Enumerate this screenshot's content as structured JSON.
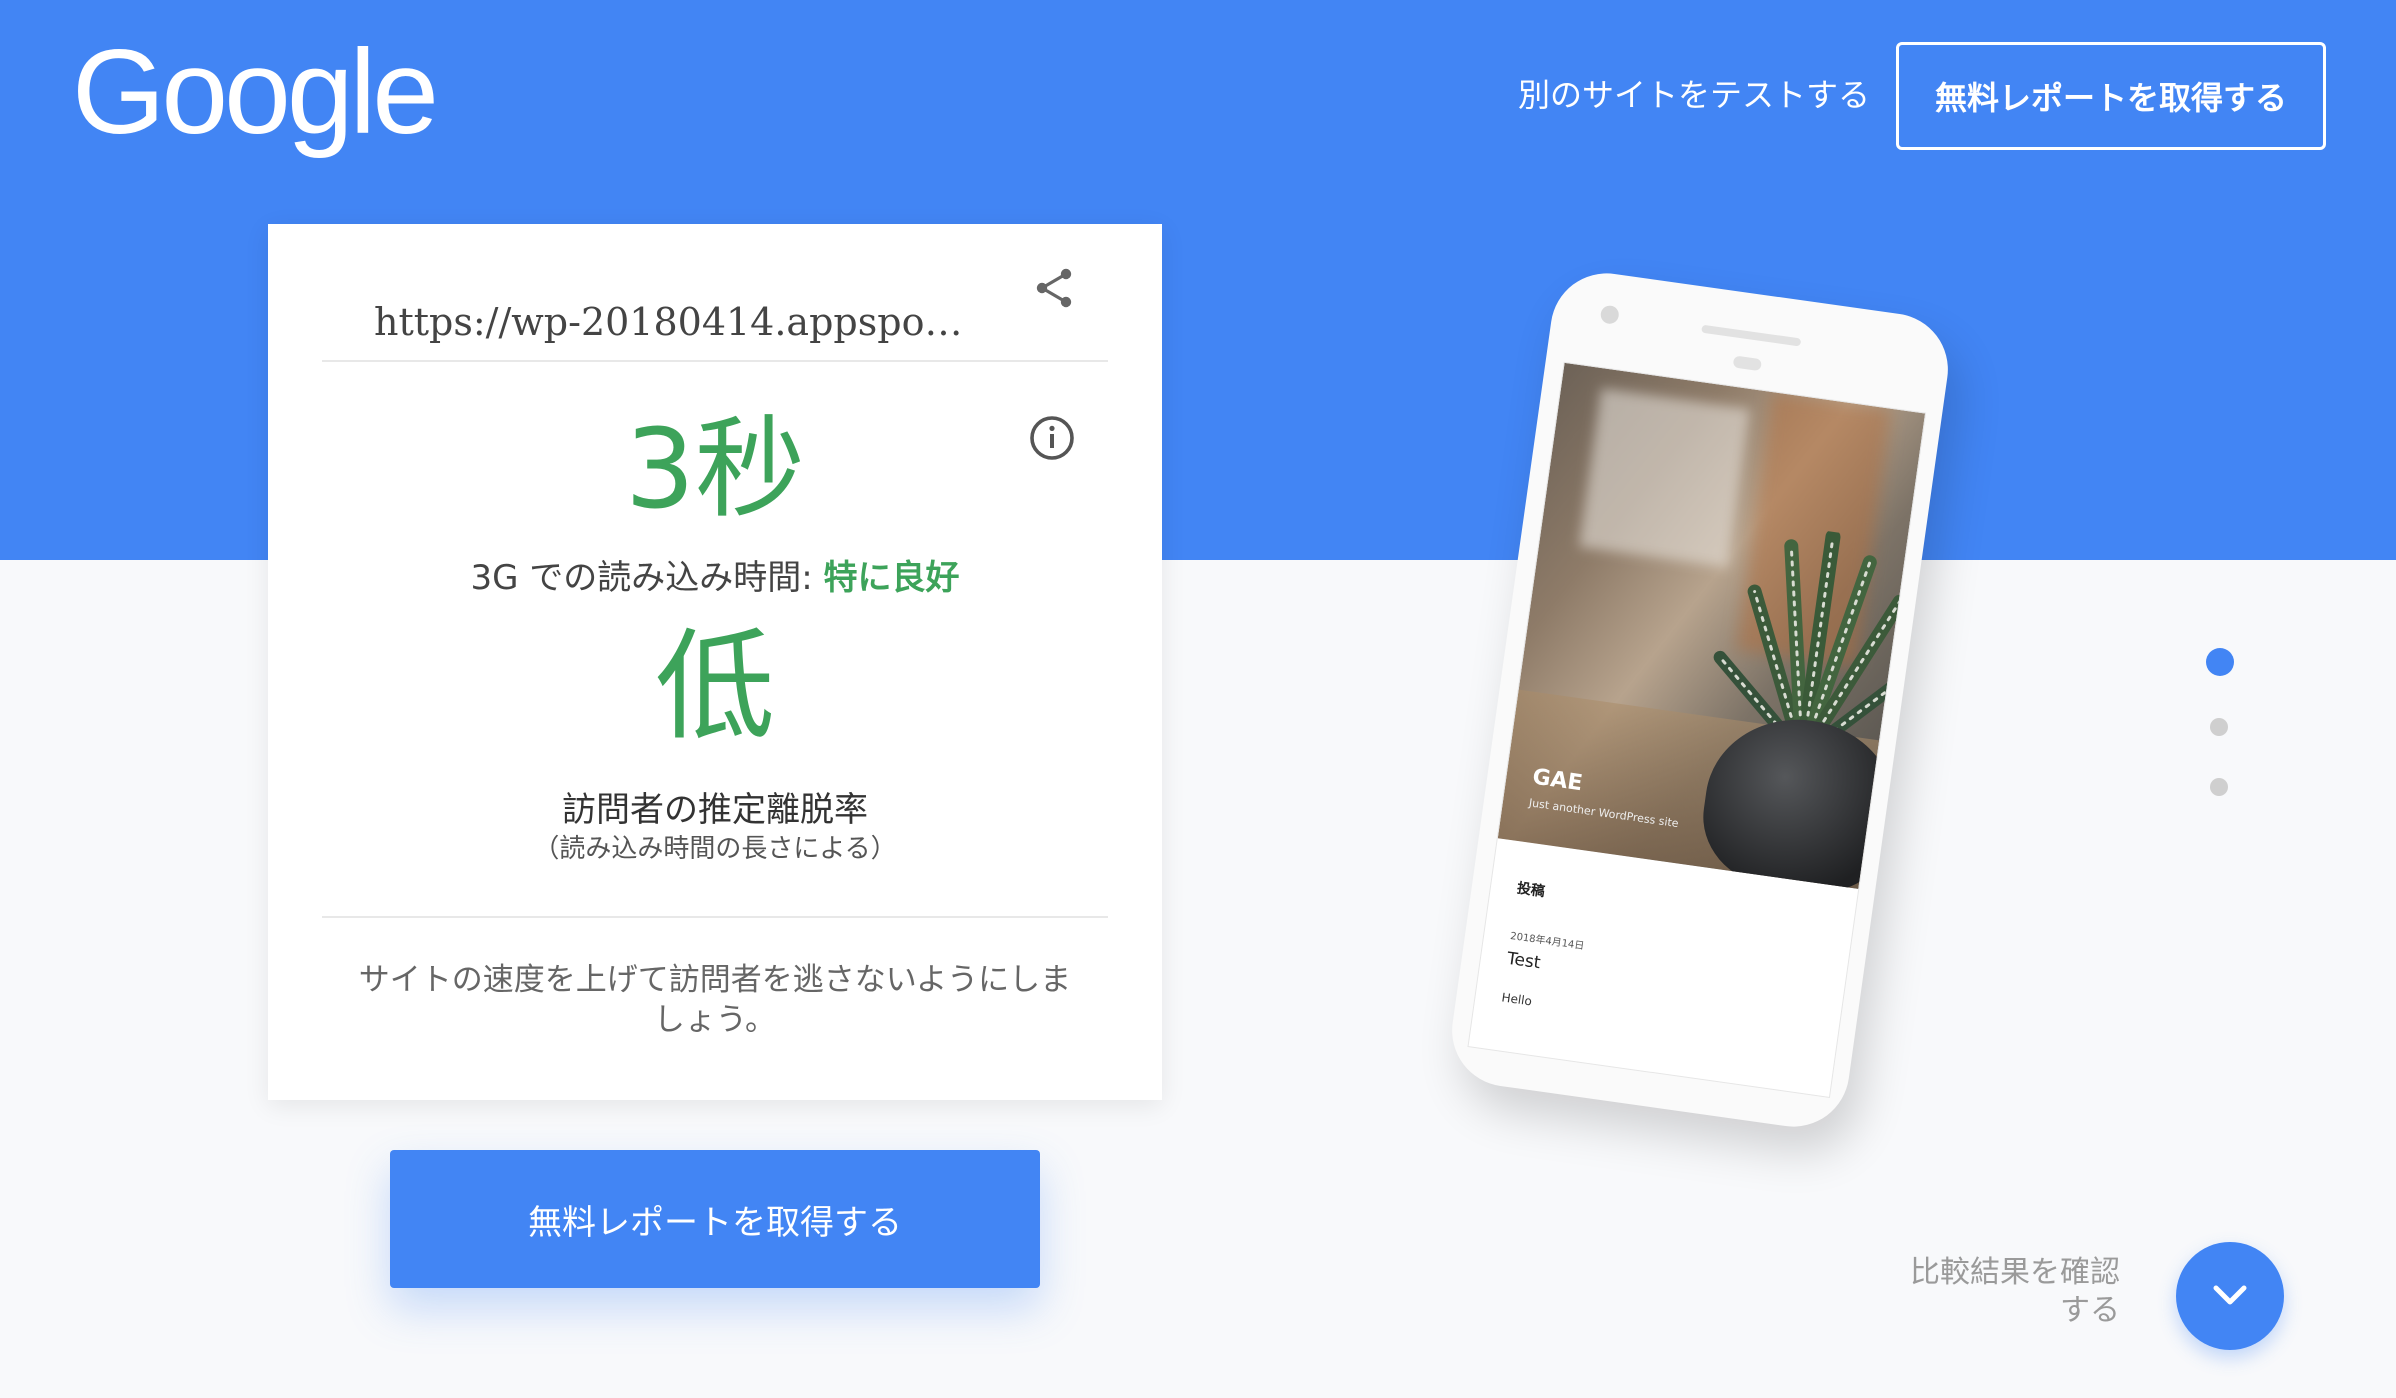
{
  "header": {
    "logo_text": "Google",
    "test_other_site": "別のサイトをテストする",
    "get_report": "無料レポートを取得する"
  },
  "result_card": {
    "url": "https://wp-20180414.appspot....",
    "load_time": "3秒",
    "load_time_caption_prefix": "3G での読み込み時間: ",
    "load_time_rating": "特に良好",
    "bounce_rate": "低",
    "bounce_label": "訪問者の推定離脱率",
    "bounce_sublabel": "（読み込み時間の長さによる）",
    "advice": "サイトの速度を上げて訪問者を逃さないようにしましょう。"
  },
  "main_cta": {
    "label": "無料レポートを取得する"
  },
  "phone_preview": {
    "site_title": "GAE",
    "site_tagline": "Just another WordPress site",
    "posts_heading": "投稿",
    "post_date": "2018年4月14日",
    "post_title": "Test",
    "post_excerpt": "Hello"
  },
  "pagination": {
    "count": 3,
    "active_index": 0
  },
  "compare": {
    "label": "比較結果を確認する"
  },
  "colors": {
    "brand_blue": "#4285f4",
    "good_green": "#3da35a",
    "background": "#f8f9fb"
  },
  "icons": [
    "share-icon",
    "info-icon",
    "chevron-down-icon"
  ]
}
